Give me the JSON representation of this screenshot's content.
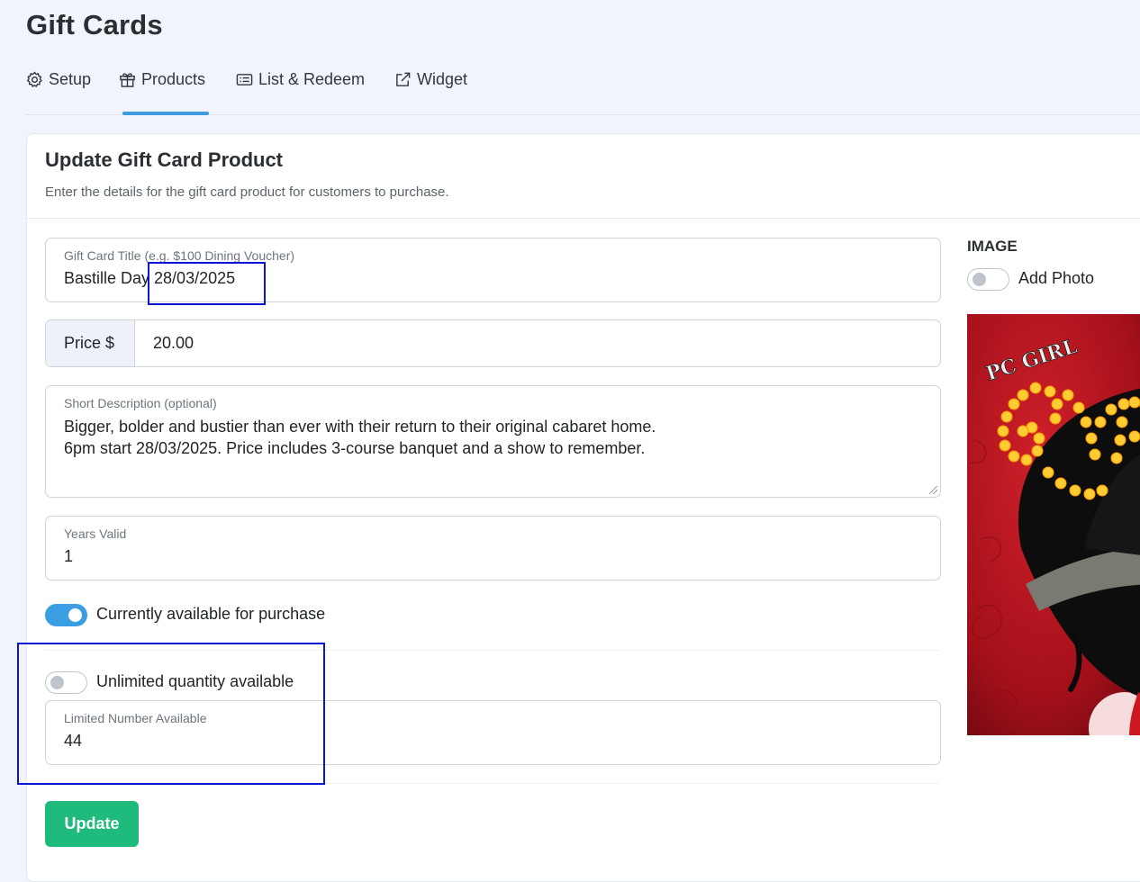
{
  "page": {
    "title": "Gift Cards"
  },
  "tabs": [
    {
      "label": "Setup",
      "icon": "gear-icon"
    },
    {
      "label": "Products",
      "icon": "gift-icon",
      "active": true
    },
    {
      "label": "List & Redeem",
      "icon": "list-card-icon"
    },
    {
      "label": "Widget",
      "icon": "external-link-icon"
    }
  ],
  "form": {
    "heading": "Update Gift Card Product",
    "subheading": "Enter the details for the gift card product for customers to purchase.",
    "title_field": {
      "label": "Gift Card Title (e.g. $100 Dining Voucher)",
      "value": "Bastille Day 28/03/2025"
    },
    "price_field": {
      "addon": "Price $",
      "value": "20.00"
    },
    "description_field": {
      "label": "Short Description (optional)",
      "value": "Bigger, bolder and bustier than ever with their return to their original cabaret home.\n6pm start 28/03/2025. Price includes 3-course banquet and a show to remember."
    },
    "years_field": {
      "label": "Years Valid",
      "value": "1"
    },
    "available_toggle": {
      "label": "Currently available for purchase",
      "on": true
    },
    "unlimited_toggle": {
      "label": "Unlimited quantity available",
      "on": false
    },
    "limited_field": {
      "label": "Limited Number Available",
      "value": "44"
    },
    "submit_label": "Update"
  },
  "image_panel": {
    "heading": "IMAGE",
    "add_photo_label": "Add Photo",
    "add_photo_on": false,
    "poster_text": "PC GIRL"
  },
  "colors": {
    "accent": "#3f9ae0",
    "toggle_on": "#3b9ee3",
    "update_button": "#1fbb7d",
    "highlight_box": "#0a14d6",
    "poster_red": "#b5121b"
  }
}
